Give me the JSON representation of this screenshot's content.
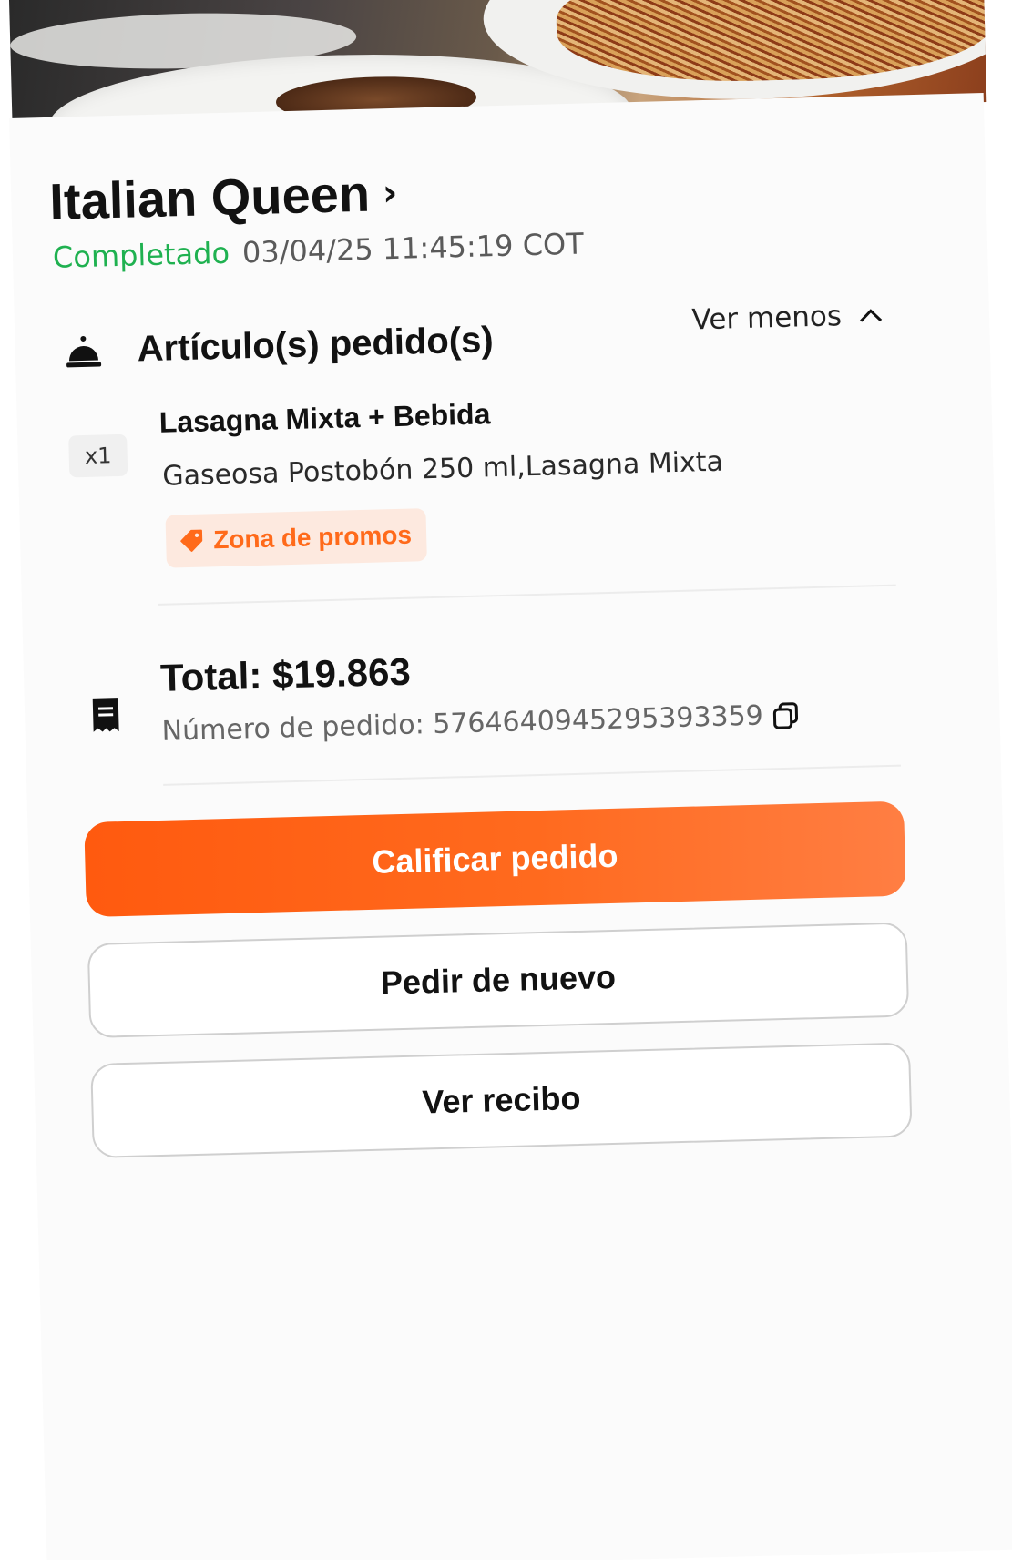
{
  "restaurant": {
    "name": "Italian Queen"
  },
  "order_status": {
    "status": "Completado",
    "timestamp": "03/04/25 11:45:19 COT"
  },
  "items_section": {
    "title": "Artículo(s) pedido(s)",
    "toggle_label": "Ver menos",
    "items": [
      {
        "quantity": "x1",
        "name": "Lasagna Mixta + Bebida",
        "description": "Gaseosa Postobón 250 ml,Lasagna Mixta",
        "promo_label": "Zona de promos"
      }
    ]
  },
  "summary": {
    "total": "Total: $19.863",
    "order_number": "Número de pedido: 5764640945295393359"
  },
  "actions": {
    "rate": "Calificar pedido",
    "reorder": "Pedir de nuevo",
    "receipt": "Ver recibo"
  },
  "colors": {
    "status_green": "#1fb150",
    "accent_orange": "#ff5a0f",
    "promo_bg": "#fde9df"
  },
  "icons": {
    "section": "service-bell-icon",
    "receipt": "receipt-icon",
    "copy": "copy-icon",
    "promo": "tag-icon"
  }
}
